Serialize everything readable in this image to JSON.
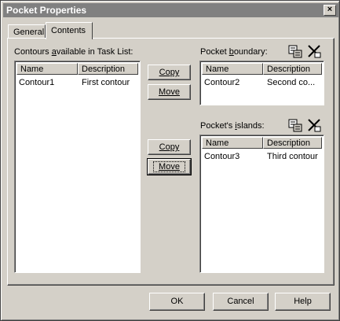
{
  "window": {
    "title": "Pocket Properties",
    "close_glyph": "×"
  },
  "tabs": [
    {
      "label": "General"
    },
    {
      "label": "Contents"
    }
  ],
  "available": {
    "label_pre": "Contours ",
    "label_mnemonic": "a",
    "label_post": "vailable in Task List:",
    "columns": [
      "Name",
      "Description"
    ],
    "rows": [
      {
        "name": "Contour1",
        "description": "First contour"
      }
    ]
  },
  "boundary": {
    "label_pre": "Pocket ",
    "label_mnemonic": "b",
    "label_post": "oundary:",
    "columns": [
      "Name",
      "Description"
    ],
    "rows": [
      {
        "name": "Contour2",
        "description": "Second co..."
      }
    ]
  },
  "islands": {
    "label_pre": "Pocket's ",
    "label_mnemonic": "i",
    "label_post": "slands:",
    "columns": [
      "Name",
      "Description"
    ],
    "rows": [
      {
        "name": "Contour3",
        "description": "Third contour"
      }
    ]
  },
  "boundary_buttons": {
    "copy": "Copy",
    "move": "Move"
  },
  "islands_buttons": {
    "copy": "Copy",
    "move": "Move"
  },
  "footer": {
    "ok": "OK",
    "cancel": "Cancel",
    "help": "Help"
  },
  "icons": {
    "properties": "list-properties-icon",
    "remove": "remove-x-icon"
  }
}
